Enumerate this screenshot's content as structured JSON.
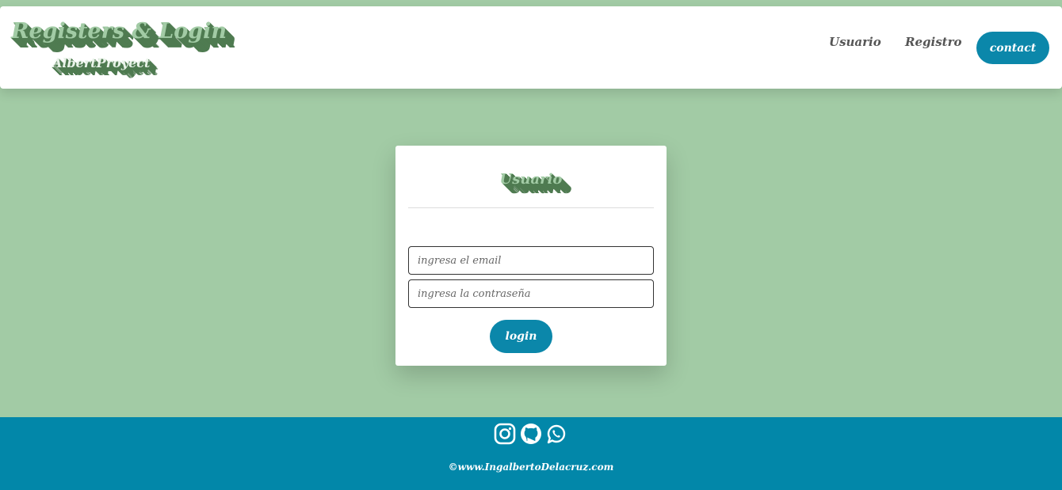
{
  "header": {
    "logo_title": "Registers & Login",
    "logo_subtitle": "AlbertProyect",
    "nav": {
      "usuario": "Usuario",
      "registro": "Registro",
      "contact": "contact"
    }
  },
  "login_card": {
    "title": "Usuario",
    "email_placeholder": "ingresa el email",
    "password_placeholder": "ingresa la contraseña",
    "login_label": "login"
  },
  "footer": {
    "icons": [
      "instagram-icon",
      "github-icon",
      "whatsapp-icon"
    ],
    "copyright": "©www.IngalbertoDelacruz.com"
  },
  "colors": {
    "background": "#a2cba5",
    "accent": "#0b87aa",
    "footer": "#0287a9",
    "title_shadow": "#4f7b51"
  }
}
